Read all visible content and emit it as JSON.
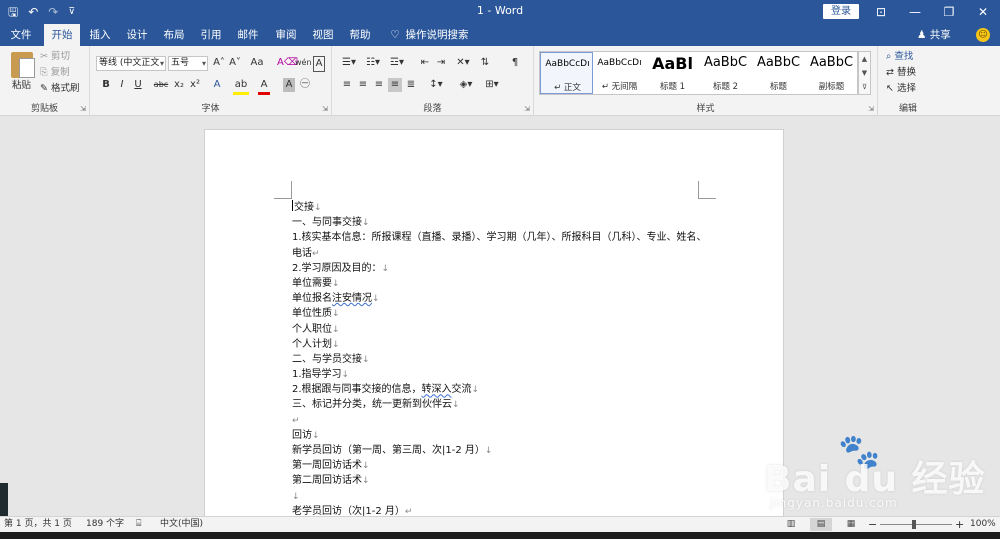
{
  "titlebar": {
    "title": "1  -  Word",
    "login": "登录",
    "qat_save": "🖫",
    "qat_undo": "↶",
    "qat_redo": "↷",
    "qat_customize": "⊽",
    "ribbon_display": "⊡",
    "minimize": "—",
    "restore": "❐",
    "close": "✕"
  },
  "tabs": [
    {
      "label": "文件"
    },
    {
      "label": "开始"
    },
    {
      "label": "插入"
    },
    {
      "label": "设计"
    },
    {
      "label": "布局"
    },
    {
      "label": "引用"
    },
    {
      "label": "邮件"
    },
    {
      "label": "审阅"
    },
    {
      "label": "视图"
    },
    {
      "label": "帮助"
    }
  ],
  "tell_me": {
    "icon": "♡",
    "label": "操作说明搜索"
  },
  "share": "♟ 共享",
  "smiley": "☺",
  "ribbon": {
    "clipboard": {
      "label": "剪贴板",
      "paste": "粘贴",
      "cut": "✂ 剪切",
      "copy": "⎘ 复制",
      "format_painter": "✎ 格式刷"
    },
    "font": {
      "label": "字体",
      "font_name": "等线 (中文正文",
      "font_size": "五号",
      "grow": "A˄",
      "shrink": "A˅",
      "case": "Aa",
      "clear": "A⌫",
      "phonetic": "wén",
      "border": "A",
      "bold": "B",
      "italic": "I",
      "underline": "U",
      "strike": "abc",
      "sub": "x₂",
      "sup": "x²",
      "effects": "A",
      "highlight": "ab",
      "color": "A",
      "shade": "A",
      "enclose": "㊀"
    },
    "paragraph": {
      "label": "段落"
    },
    "styles": {
      "label": "样式",
      "items": [
        {
          "preview": "AaBbCcDı",
          "name": "↵ 正文"
        },
        {
          "preview": "AaBbCcDı",
          "name": "↵ 无间隔"
        },
        {
          "preview": "AaBl",
          "name": "标题 1"
        },
        {
          "preview": "AaBbC",
          "name": "标题 2"
        },
        {
          "preview": "AaBbC",
          "name": "标题"
        },
        {
          "preview": "AaBbC",
          "name": "副标题"
        }
      ]
    },
    "editing": {
      "label": "编辑",
      "find": "⌕ 查找",
      "replace": "⇄ 替换",
      "select": "↖ 选择"
    }
  },
  "document": {
    "lines": [
      {
        "text": "交接",
        "mark": "↓"
      },
      {
        "text": "一、与同事交接",
        "mark": "↓"
      },
      {
        "text": "1.核实基本信息：所报课程（直播、录播）、学习期（几年）、所报科目（几科）、专业、姓名、",
        "mark": ""
      },
      {
        "text": "电话",
        "mark": "↵"
      },
      {
        "text": "2.学习原因及目的：",
        "mark": "↓"
      },
      {
        "text": "单位需要",
        "mark": "↓"
      },
      {
        "text": "单位报名",
        "squig": "注安情况",
        "mark": "↓"
      },
      {
        "text": "单位性质",
        "mark": "↓"
      },
      {
        "text": "个人职位",
        "mark": "↓"
      },
      {
        "text": "个人计划",
        "mark": "↓"
      },
      {
        "text": "二、与学员交接",
        "mark": "↓"
      },
      {
        "text": "1.指导学习",
        "mark": "↓"
      },
      {
        "text": "2.根据跟与同事交接的信息，",
        "squig": "转深入",
        "after": "交流",
        "mark": "↓"
      },
      {
        "text": "三、标记并分类，统一更新到伙伴云",
        "mark": "↓"
      },
      {
        "text": "",
        "mark": "↵"
      },
      {
        "text": "回访",
        "mark": "↓"
      },
      {
        "text": "新学员回访（第一周、第三周、次|1-2 月）",
        "mark": "↓"
      },
      {
        "text": "第一周回访话术",
        "mark": "↓"
      },
      {
        "text": "第二周回访话术",
        "mark": "↓"
      },
      {
        "text": "",
        "mark": "↓"
      },
      {
        "text": "老学员回访（次|1-2 月）",
        "mark": "↵"
      }
    ]
  },
  "watermark": {
    "paw": "🐾",
    "main": "Bai du 经验",
    "sub": "jingyan.baidu.com"
  },
  "statusbar": {
    "page": "第 1 页，共 1 页",
    "words": "189 个字",
    "proof_icon": "⌸",
    "language": "中文(中国)",
    "zoom_minus": "−",
    "zoom_plus": "+",
    "zoom": "100%"
  }
}
